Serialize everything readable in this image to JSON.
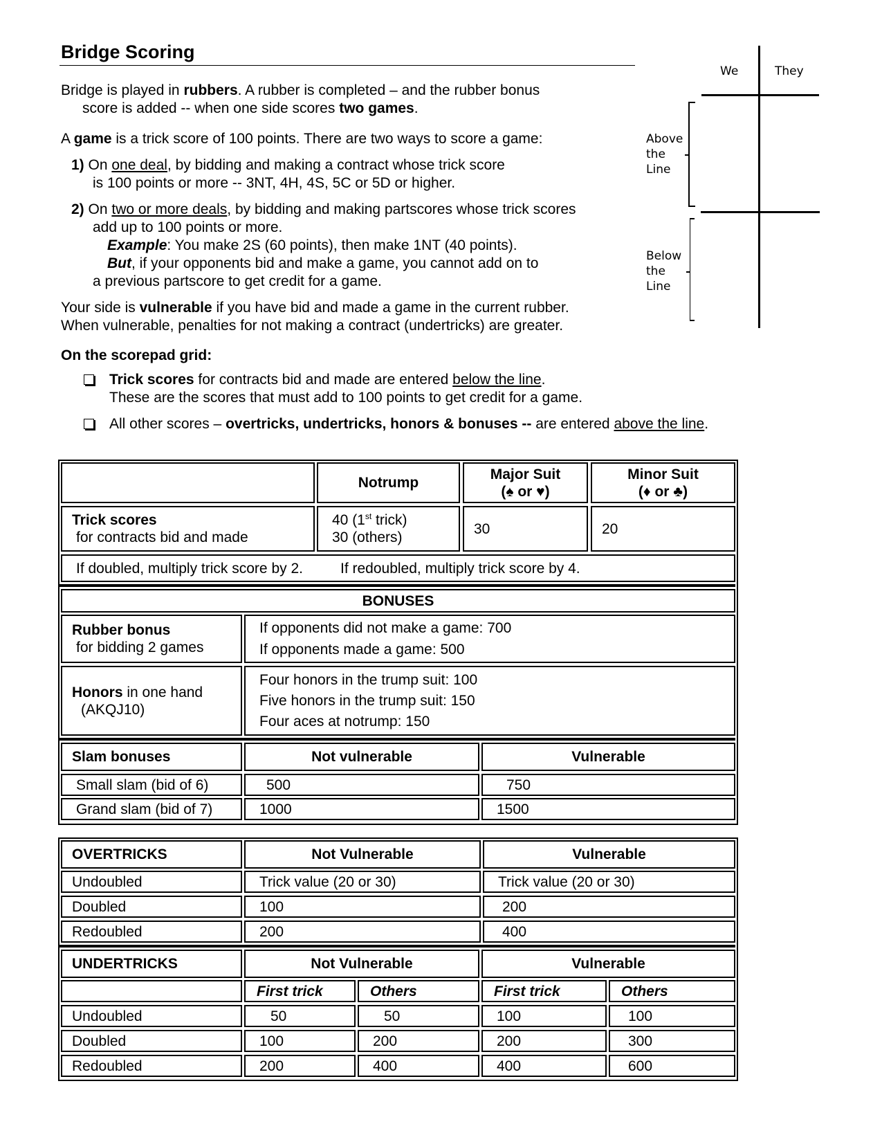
{
  "title": "Bridge Scoring",
  "intro": {
    "p1_a": "Bridge is played in ",
    "p1_b": "rubbers",
    "p1_c": ". A rubber is completed – and the rubber bonus",
    "p1_line2_a": "score is added -- when one side scores ",
    "p1_line2_b": "two games",
    "p1_line2_c": ".",
    "p2_a": "A ",
    "p2_b": "game",
    "p2_c": " is a trick score of 100 points. There are two ways to score a game:",
    "way1_num": "1)",
    "way1_a": " On ",
    "way1_u": "one deal",
    "way1_b": ", by bidding and making a contract whose trick score",
    "way1_line2": "is 100 points or more -- 3NT, 4H, 4S, 5C or 5D or higher.",
    "way2_num": "2)",
    "way2_a": " On ",
    "way2_u": "two or more deals",
    "way2_b": ", by bidding and making partscores whose trick scores",
    "way2_line2": "add up to 100 points or more.",
    "example_label": "Example",
    "example_text": ": You make 2S (60 points), then make 1NT (40 points).",
    "but_label": "But",
    "but_text": ", if your opponents bid and make a game, you cannot add on to",
    "but_line2": "a previous partscore to get credit for a game.",
    "vul_a": "Your side is ",
    "vul_b": "vulnerable",
    "vul_c": " if you have bid and made a game in the current rubber.",
    "vul_line2": "When vulnerable, penalties for not making a contract (undertricks) are greater."
  },
  "scorepad_section": {
    "heading": "On the scorepad grid:",
    "item1_b": "Trick scores",
    "item1_a": " for contracts bid and made are entered ",
    "item1_u": "below the line",
    "item1_end": ".",
    "item1_line2": "These are the scores that must add to 100 points to get credit for a game.",
    "item2_a": "All other scores – ",
    "item2_b": "overtricks, undertricks, honors & bonuses --",
    "item2_c": " are entered ",
    "item2_u": "above the line",
    "item2_end": "."
  },
  "scorepad": {
    "col_we": "We",
    "col_they": "They",
    "above_label": [
      "Above",
      "the",
      "Line"
    ],
    "below_label": [
      "Below",
      "the",
      "Line"
    ]
  },
  "trick_table": {
    "headers": [
      "",
      "Notrump",
      "Major Suit",
      "Minor Suit"
    ],
    "major_suits": "(♠ or ♥)",
    "minor_suits": "(♦ or ♣)",
    "row_label": "Trick scores",
    "row_sublabel": "for contracts bid and made",
    "notrump_line1_pre": "40 (1",
    "notrump_line1_sup": "st",
    "notrump_line1_post": " trick)",
    "notrump_line2": "30 (others)",
    "major_value": "30",
    "minor_value": "20",
    "doubled_note": "If doubled, multiply trick score by 2.",
    "redoubled_note": "If redoubled, multiply trick score by 4."
  },
  "bonuses": {
    "heading": "BONUSES",
    "rubber_label": "Rubber bonus",
    "rubber_sublabel": "for bidding 2 games",
    "rubber_values": [
      "If opponents did not make a game: 700",
      "If opponents made a game:  500"
    ],
    "honors_label": "Honors",
    "honors_label_rest": " in one hand",
    "honors_sublabel": "(AKQJ10)",
    "honors_values": [
      "Four honors in the trump suit: 100",
      "Five honors in the trump suit: 150",
      "Four aces at notrump: 150"
    ],
    "slam_headers": [
      "Slam bonuses",
      "Not vulnerable",
      "Vulnerable"
    ],
    "slam_rows": [
      {
        "label": "Small slam (bid of 6)",
        "not_vul": "500",
        "vul": "750"
      },
      {
        "label": "Grand slam (bid of 7)",
        "not_vul": "1000",
        "vul": "1500"
      }
    ]
  },
  "overtricks": {
    "headers": [
      "OVERTRICKS",
      "Not Vulnerable",
      "Vulnerable"
    ],
    "rows": [
      {
        "label": "Undoubled",
        "not_vul": "Trick value (20 or 30)",
        "vul": "Trick value (20 or 30)"
      },
      {
        "label": "Doubled",
        "not_vul": "100",
        "vul": "200"
      },
      {
        "label": "Redoubled",
        "not_vul": "200",
        "vul": "400"
      }
    ]
  },
  "undertricks": {
    "headers": [
      "UNDERTRICKS",
      "Not Vulnerable",
      "Vulnerable"
    ],
    "subheaders": [
      "",
      "First trick",
      "Others",
      "First trick",
      "Others"
    ],
    "rows": [
      {
        "label": "Undoubled",
        "nv_first": "50",
        "nv_others": "50",
        "v_first": "100",
        "v_others": "100"
      },
      {
        "label": "Doubled",
        "nv_first": "100",
        "nv_others": "200",
        "v_first": "200",
        "v_others": "300"
      },
      {
        "label": "Redoubled",
        "nv_first": "200",
        "nv_others": "400",
        "v_first": "400",
        "v_others": "600"
      }
    ]
  }
}
